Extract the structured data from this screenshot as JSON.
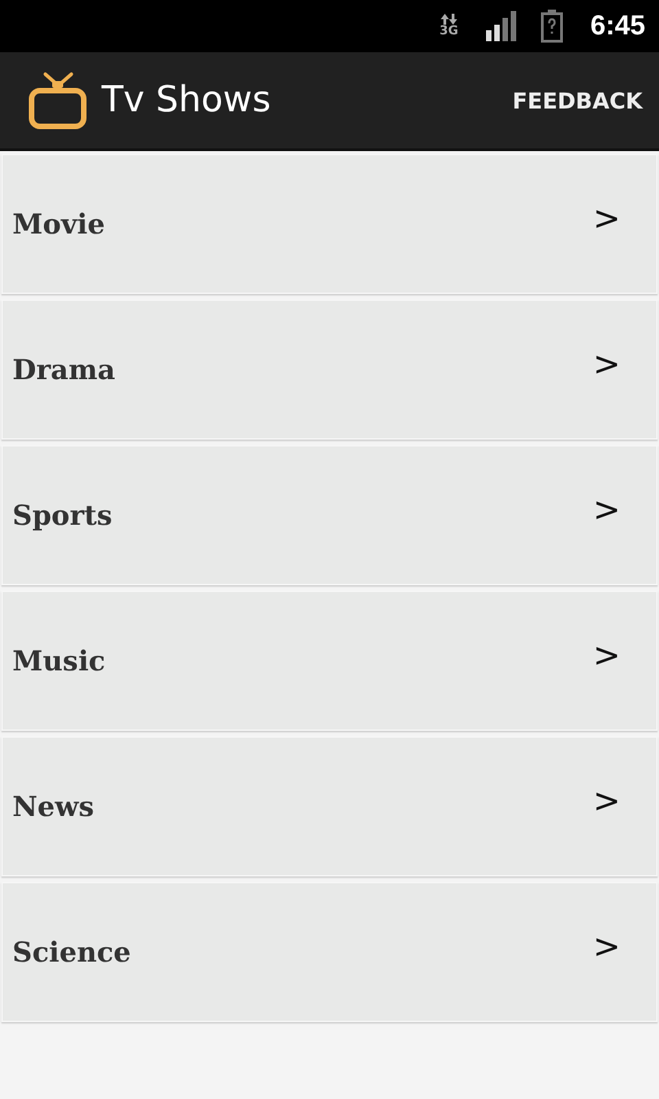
{
  "status_bar": {
    "network": "3G",
    "time": "6:45"
  },
  "app_bar": {
    "title": "Tv Shows",
    "action": "FEEDBACK"
  },
  "categories": [
    {
      "label": "Movie",
      "arrow": ">"
    },
    {
      "label": "Drama",
      "arrow": ">"
    },
    {
      "label": "Sports",
      "arrow": ">"
    },
    {
      "label": "Music",
      "arrow": ">"
    },
    {
      "label": "News",
      "arrow": ">"
    },
    {
      "label": "Science",
      "arrow": ">"
    }
  ]
}
